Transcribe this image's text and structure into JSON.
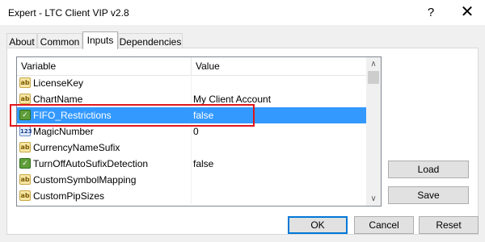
{
  "window": {
    "title": "Expert - LTC Client VIP v2.8",
    "help_label": "?",
    "close_label": "✕"
  },
  "tabs": [
    {
      "label": "About",
      "active": false
    },
    {
      "label": "Common",
      "active": false
    },
    {
      "label": "Inputs",
      "active": true
    },
    {
      "label": "Dependencies",
      "active": false
    }
  ],
  "grid": {
    "headers": {
      "variable": "Variable",
      "value": "Value"
    },
    "rows": [
      {
        "icon": "ab",
        "variable": "LicenseKey",
        "value": "",
        "selected": false
      },
      {
        "icon": "ab",
        "variable": "ChartName",
        "value": "My Client Account",
        "selected": false
      },
      {
        "icon": "bool",
        "variable": "FIFO_Restrictions",
        "value": "false",
        "selected": true
      },
      {
        "icon": "123",
        "variable": "MagicNumber",
        "value": "0",
        "selected": false
      },
      {
        "icon": "ab",
        "variable": "CurrencyNameSufix",
        "value": "",
        "selected": false
      },
      {
        "icon": "bool",
        "variable": "TurnOffAutoSufixDetection",
        "value": "false",
        "selected": false
      },
      {
        "icon": "ab",
        "variable": "CustomSymbolMapping",
        "value": "",
        "selected": false
      },
      {
        "icon": "ab",
        "variable": "CustomPipSizes",
        "value": "",
        "selected": false
      }
    ]
  },
  "side_buttons": {
    "load": "Load",
    "save": "Save"
  },
  "footer_buttons": {
    "ok": "OK",
    "cancel": "Cancel",
    "reset": "Reset"
  },
  "colors": {
    "selection": "#3399ff",
    "highlight_box": "#e0161c",
    "default_button_border": "#0078d7"
  },
  "icons": {
    "string_type": "ab-string-icon",
    "bool_type": "bool-check-icon",
    "number_type": "123-number-icon",
    "scroll_up": "chevron-up-icon",
    "scroll_down": "chevron-down-icon",
    "help": "help-icon",
    "close": "close-icon"
  }
}
